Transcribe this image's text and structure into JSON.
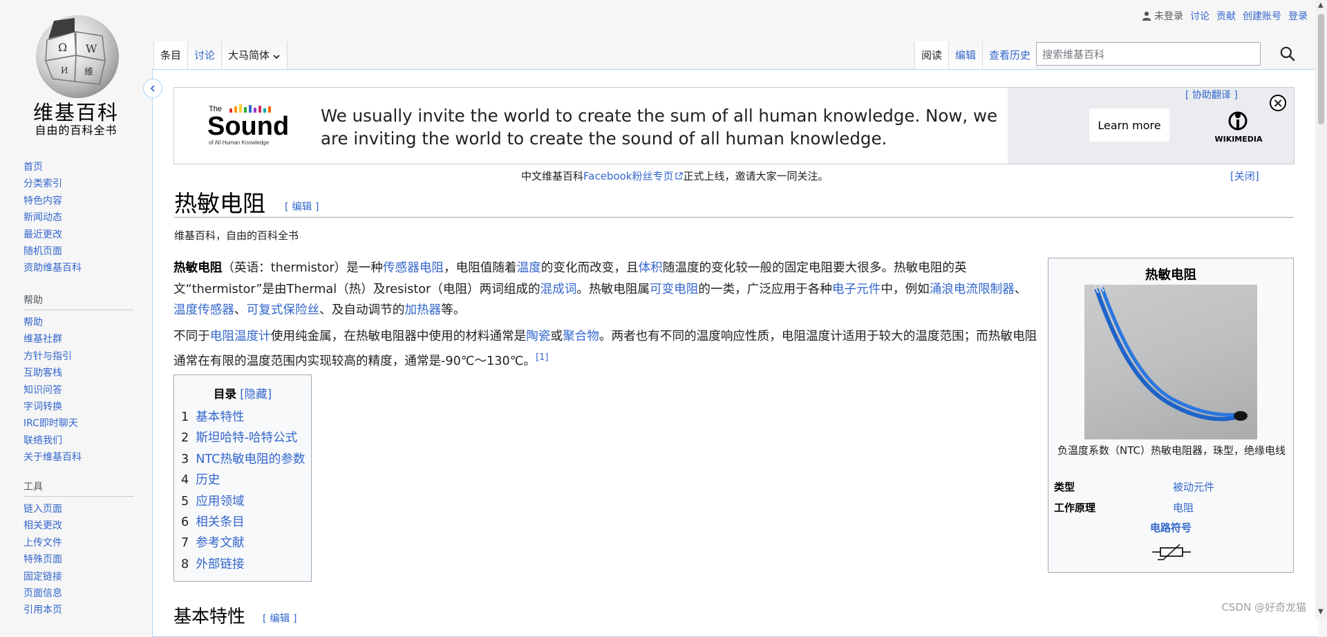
{
  "personal": {
    "not_logged_in": "未登录",
    "talk": "讨论",
    "contributions": "贡献",
    "create_account": "创建账号",
    "login": "登录"
  },
  "logo": {
    "wordmark": "维基百科",
    "tagline": "自由的百科全书"
  },
  "nav_main": [
    "首页",
    "分类索引",
    "特色内容",
    "新闻动态",
    "最近更改",
    "随机页面",
    "资助维基百科"
  ],
  "nav_help": {
    "header": "帮助",
    "items": [
      "帮助",
      "维基社群",
      "方针与指引",
      "互助客栈",
      "知识问答",
      "字词转换",
      "IRC即时聊天",
      "联络我们",
      "关于维基百科"
    ]
  },
  "nav_tools": {
    "header": "工具",
    "items": [
      "链入页面",
      "相关更改",
      "上传文件",
      "特殊页面",
      "固定链接",
      "页面信息",
      "引用本页"
    ]
  },
  "tabs_left": {
    "article": "条目",
    "talk": "讨论",
    "variant": "大马简体"
  },
  "tabs_right": {
    "read": "阅读",
    "edit": "编辑",
    "history": "查看历史"
  },
  "search": {
    "placeholder": "搜索维基百科"
  },
  "banner": {
    "message": "We usually invite the world to create the sum of all human knowledge. Now, we are inviting the world to create the sound of all human knowledge.",
    "logo_small": "The",
    "logo_big": "Sound",
    "logo_sub": "of All Human Knowledge",
    "learn_more": "Learn more",
    "assist_translate": "[ 协助翻译 ]",
    "wikimedia": "WIKIMEDIA"
  },
  "notice": {
    "prefix": "中文维基百科",
    "link": "Facebook粉丝专页",
    "suffix": "正式上线，邀请大家一同关注。",
    "close": "[关闭]"
  },
  "article": {
    "title": "热敏电阻",
    "edit_label": "[ 编辑 ]",
    "from": "维基百科，自由的百科全书",
    "p1": {
      "bold": "热敏电阻",
      "t1": "（英语：thermistor）是一种",
      "l1": "传感器电阻",
      "t2": "，电阻值随着",
      "l2": "温度",
      "t3": "的变化而改变，且",
      "l3": "体积",
      "t4": "随温度的变化较一般的固定电阻要大很多。热敏电阻的英文“thermistor”是由Thermal（热）及resistor（电阻）两词组成的",
      "l4": "混成词",
      "t5": "。热敏电阻属",
      "l5": "可变电阻",
      "t6": "的一类，广泛应用于各种",
      "l6": "电子元件",
      "t7": "中，例如",
      "l7": "涌浪电流限制器",
      "t8": "、",
      "l8": "温度传感器",
      "t9": "、",
      "l9": "可复式保险丝",
      "t10": "、及自动调节的",
      "l10": "加热器",
      "t11": "等。"
    },
    "p2": {
      "t1": "不同于",
      "l1": "电阻温度计",
      "t2": "使用纯金属，在热敏电阻器中使用的材料通常是",
      "l2": "陶瓷",
      "t3": "或",
      "l3": "聚合物",
      "t4": "。两者也有不同的温度响应性质，电阻温度计适用于较大的温度范围；而热敏电阻通常在有限的温度范围内实现较高的精度，通常是-90℃～130℃。",
      "ref": "[1]"
    },
    "section1": "基本特性",
    "section1_edit": "[ 编辑 ]"
  },
  "toc": {
    "title": "目录",
    "hide": "[隐藏]",
    "items": [
      {
        "num": "1",
        "label": "基本特性"
      },
      {
        "num": "2",
        "label": "斯坦哈特-哈特公式"
      },
      {
        "num": "3",
        "label": "NTC热敏电阻的参数"
      },
      {
        "num": "4",
        "label": "历史"
      },
      {
        "num": "5",
        "label": "应用领域"
      },
      {
        "num": "6",
        "label": "相关条目"
      },
      {
        "num": "7",
        "label": "参考文献"
      },
      {
        "num": "8",
        "label": "外部链接"
      }
    ]
  },
  "infobox": {
    "title": "热敏电阻",
    "caption": "负温度系数（NTC）热敏电阻器，珠型，绝缘电线",
    "type_key": "类型",
    "type_val": "被动元件",
    "principle_key": "工作原理",
    "principle_val": "电阻",
    "symbol_header": "电路符号"
  },
  "watermark": "CSDN @好奇龙猫",
  "colors": {
    "link": "#3366cc",
    "border": "#a7d7f9",
    "text": "#202122"
  }
}
